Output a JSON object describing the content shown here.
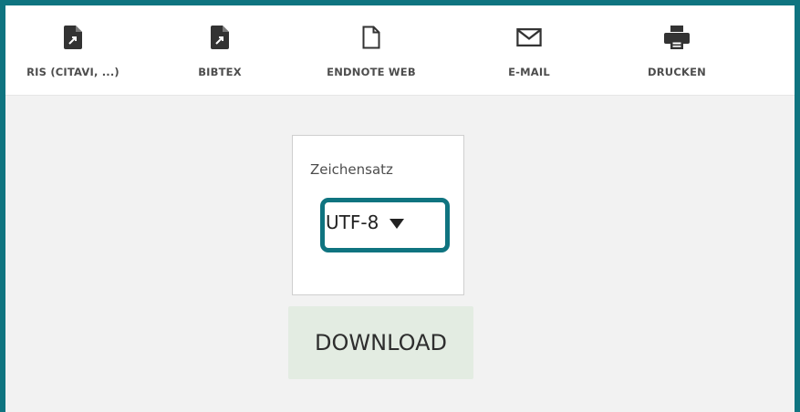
{
  "toolbar": {
    "items": [
      {
        "label": "RIS (CITAVI, ...)",
        "icon": "file-export-icon"
      },
      {
        "label": "BIBTEX",
        "icon": "file-export-icon"
      },
      {
        "label": "ENDNOTE WEB",
        "icon": "document-outline-icon"
      },
      {
        "label": "E-MAIL",
        "icon": "envelope-icon"
      },
      {
        "label": "DRUCKEN",
        "icon": "printer-icon"
      }
    ]
  },
  "export_panel": {
    "charset_label": "Zeichensatz",
    "charset_value": "UTF-8",
    "download_label": "DOWNLOAD"
  },
  "colors": {
    "accent": "#0f7480",
    "download_bg": "#e3ece2",
    "panel_bg": "#f2f2f2"
  }
}
